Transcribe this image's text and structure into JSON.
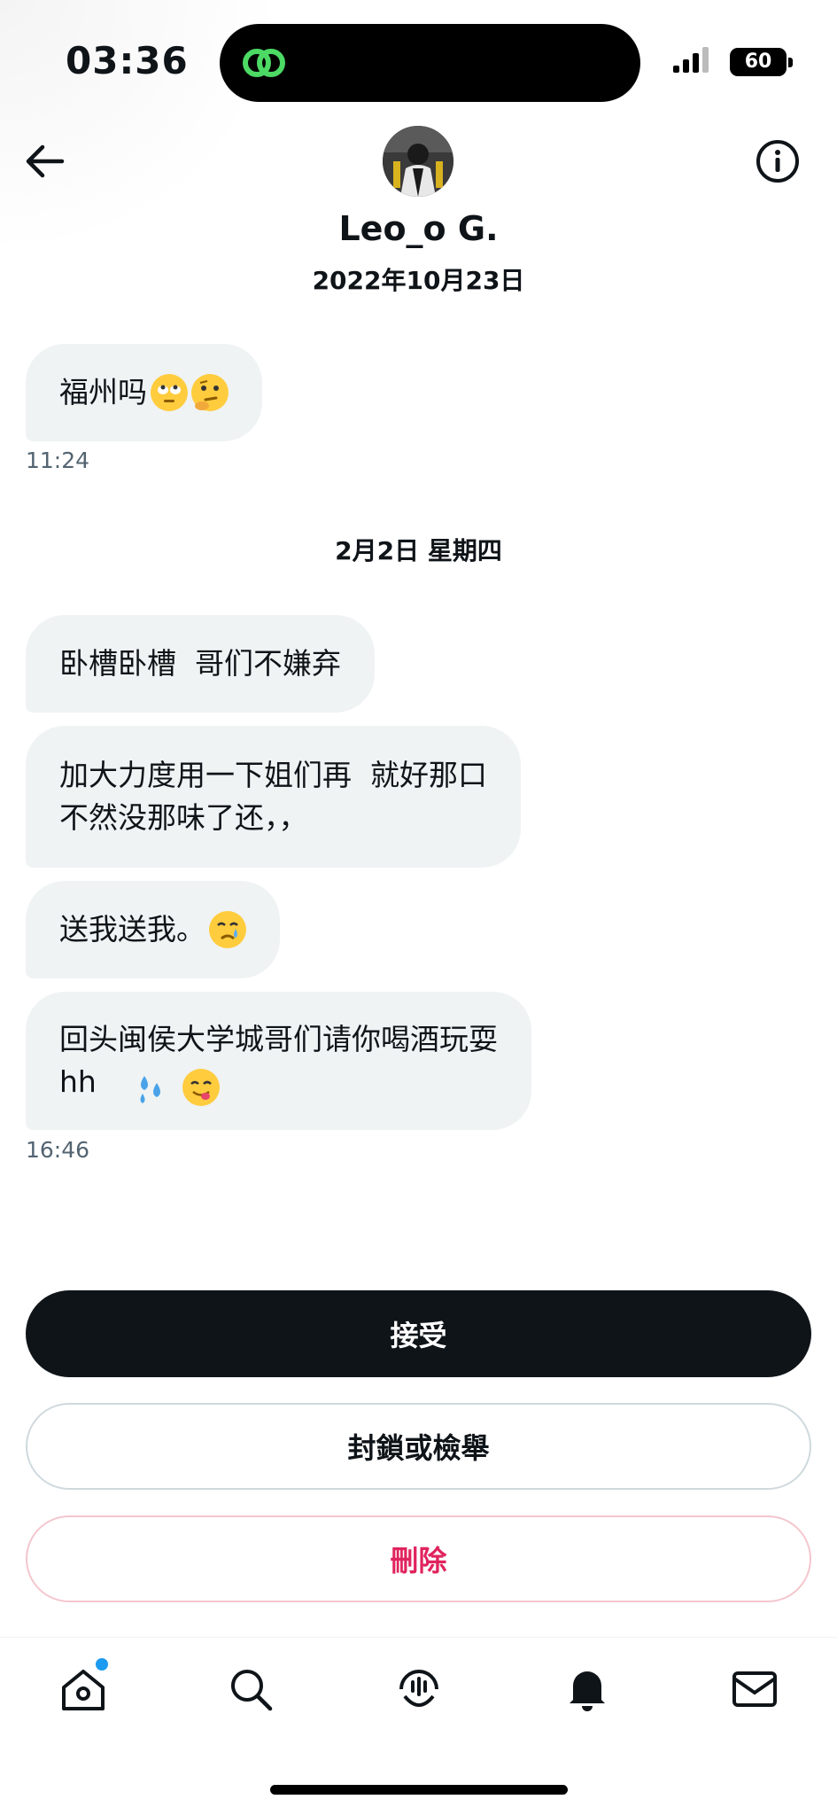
{
  "status_bar": {
    "time": "03:36",
    "battery": "60"
  },
  "header": {
    "contact_name": "Leo_o G.",
    "conversation_date": "2022年10月23日"
  },
  "messages_day1": [
    {
      "text": "福州吗",
      "emojis": [
        "face-with-rolling-eyes-emoji",
        "thinking-face-emoji"
      ]
    }
  ],
  "time1": "11:24",
  "day_separator": "2月2日 星期四",
  "messages_day2": [
    {
      "text": "卧槽卧槽  哥们不嫌弃"
    },
    {
      "text": "加大力度用一下姐们再  就好那口\n不然没那味了还，，"
    },
    {
      "text": "送我送我。",
      "emojis": [
        "crying-face-emoji"
      ]
    },
    {
      "text": "回头闽侯大学城哥们请你喝酒玩耍\nhh  ",
      "emojis": [
        "sweat-droplets-emoji",
        "face-savoring-food-emoji"
      ]
    }
  ],
  "time2": "16:46",
  "actions": {
    "accept": "接受",
    "block_or_report": "封鎖或檢舉",
    "delete": "刪除"
  },
  "tabs": [
    "home-icon",
    "search-icon",
    "spaces-icon",
    "notifications-icon",
    "messages-icon"
  ],
  "colors": {
    "bubble": "#eff3f4",
    "primary_text": "#0f1419",
    "secondary_text": "#536471",
    "danger": "#e0245e",
    "accent": "#1d9bf0"
  }
}
